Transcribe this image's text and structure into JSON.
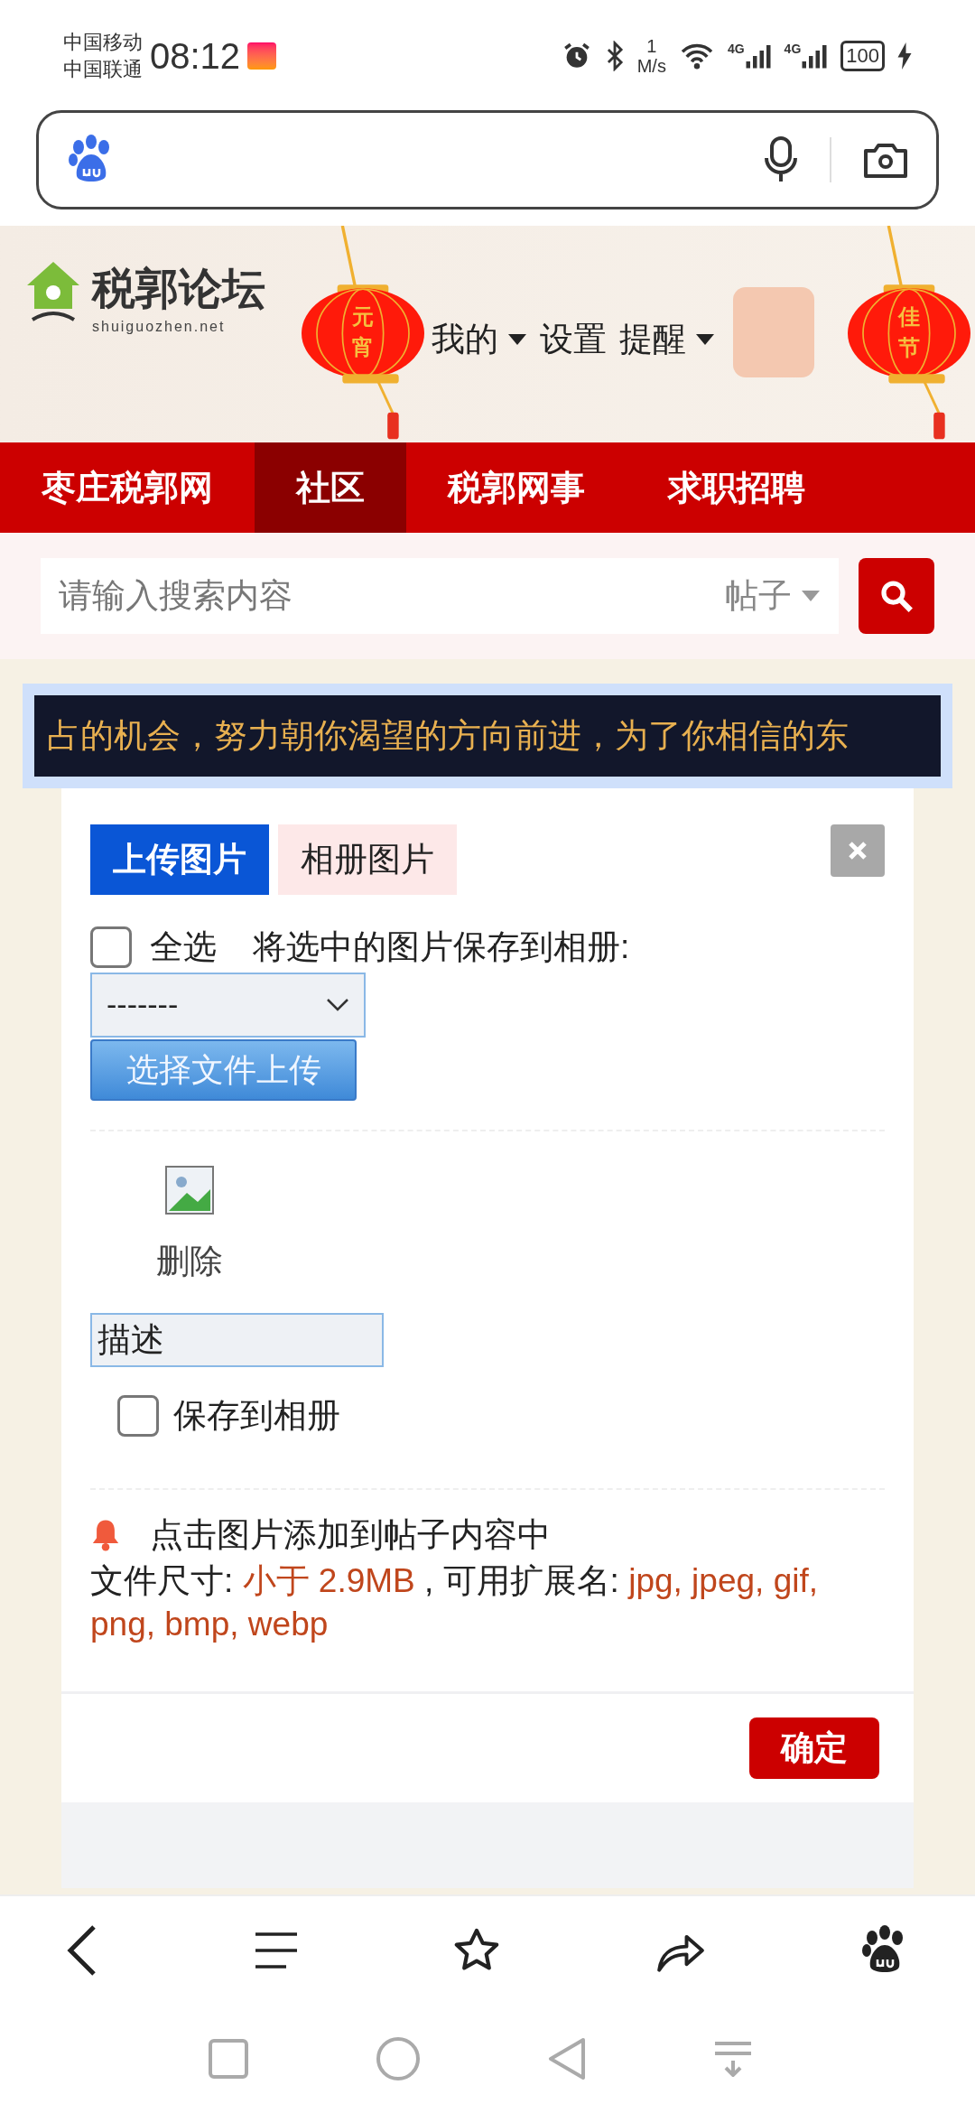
{
  "status_bar": {
    "carriers": [
      "中国移动",
      "中国联通"
    ],
    "time": "08:12",
    "speed_value": "1",
    "speed_unit": "M/s",
    "network_labels": [
      "4G",
      "4G"
    ],
    "battery": "100"
  },
  "site_header": {
    "logo_title": "税郭论坛",
    "logo_url": "shuiguozhen.net",
    "user_links": [
      {
        "label": "我的",
        "dropdown": true
      },
      {
        "label": "设置",
        "dropdown": false
      },
      {
        "label": "提醒",
        "dropdown": true
      }
    ],
    "lanterns": [
      {
        "text": "元宵"
      },
      {
        "text": "佳节"
      }
    ]
  },
  "nav": {
    "items": [
      {
        "label": "枣庄税郭网",
        "selected": false
      },
      {
        "label": "社区",
        "selected": true
      },
      {
        "label": "税郭网事",
        "selected": false
      },
      {
        "label": "求职招聘",
        "selected": false
      }
    ]
  },
  "search": {
    "placeholder": "请输入搜索内容",
    "scope": "帖子"
  },
  "marquee": {
    "text": "占的机会，努力朝你渴望的方向前进，为了你相信的东"
  },
  "dialog": {
    "tabs": [
      {
        "label": "上传图片",
        "selected": true
      },
      {
        "label": "相册图片",
        "selected": false
      }
    ],
    "select_all": {
      "label": "全选",
      "checked": false
    },
    "save_selected_label": "将选中的图片保存到相册:",
    "album_select": "-------",
    "upload_button": "选择文件上传",
    "image": {
      "delete_label": "删除",
      "description": "描述",
      "save_to_album": {
        "label": "保存到相册",
        "checked": false
      }
    },
    "hint": "点击图片添加到帖子内容中",
    "file_info": [
      {
        "text": "文件尺寸: ",
        "highlight": false
      },
      {
        "text": "小于 2.9MB",
        "highlight": true
      },
      {
        "text": " , 可用扩展名: ",
        "highlight": false
      },
      {
        "text": "jpg, jpeg, gif, png, bmp, webp",
        "highlight": true
      }
    ],
    "confirm_button": "确定"
  }
}
